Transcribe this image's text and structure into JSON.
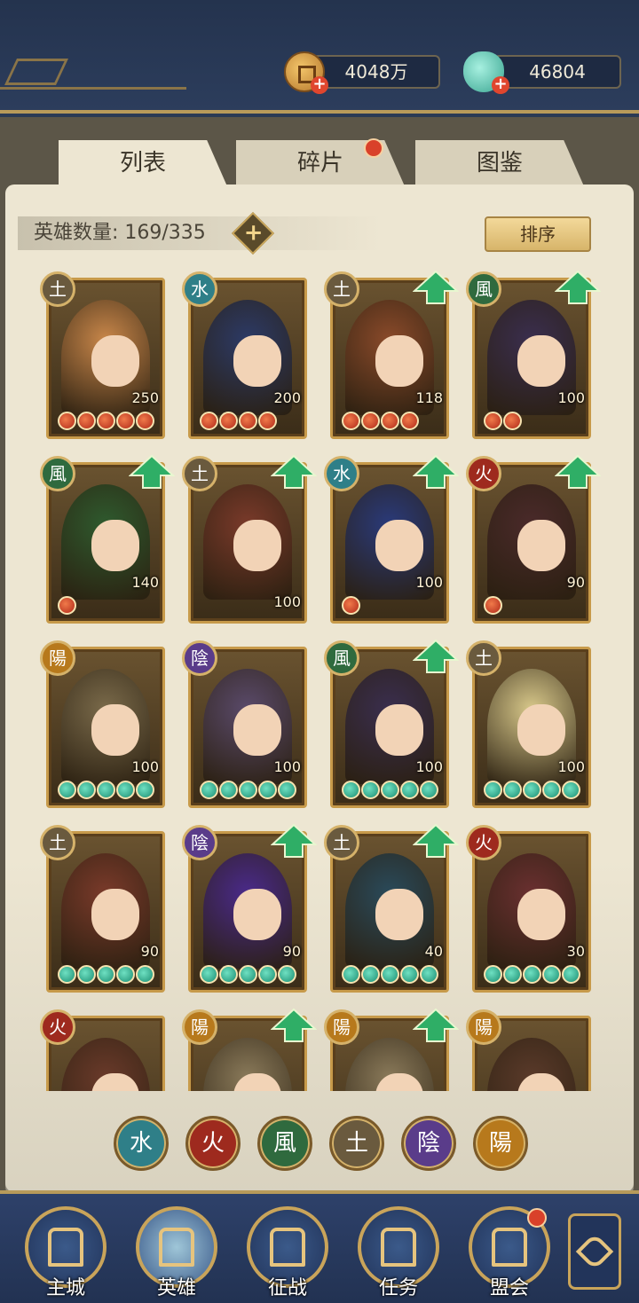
{
  "currencies": {
    "coins": "4048万",
    "jade": "46804"
  },
  "tabs": [
    {
      "label": "列表"
    },
    {
      "label": "碎片"
    },
    {
      "label": "图鉴"
    }
  ],
  "hero_count_label": "英雄数量: 169/335",
  "add_label": "+",
  "sort_label": "排序",
  "element_glyphs": {
    "water": "水",
    "fire": "火",
    "wind": "風",
    "earth": "土",
    "yin": "陰",
    "yang": "陽"
  },
  "element_colors": {
    "water": "#2f7f88",
    "fire": "#9e2a1e",
    "wind": "#2f6a3e",
    "earth": "#6a5a3e",
    "yin": "#5a3c8a",
    "yang": "#b7791c"
  },
  "heroes": [
    {
      "element": "earth",
      "level": "250",
      "stars": 5,
      "star_type": "red",
      "upgrade": false
    },
    {
      "element": "water",
      "level": "200",
      "stars": 4,
      "star_type": "red",
      "upgrade": false
    },
    {
      "element": "earth",
      "level": "118",
      "stars": 4,
      "star_type": "red",
      "upgrade": true
    },
    {
      "element": "wind",
      "level": "100",
      "stars": 2,
      "star_type": "red",
      "upgrade": true
    },
    {
      "element": "wind",
      "level": "140",
      "stars": 1,
      "star_type": "red",
      "upgrade": true
    },
    {
      "element": "earth",
      "level": "100",
      "stars": 0,
      "star_type": "red",
      "upgrade": true
    },
    {
      "element": "water",
      "level": "100",
      "stars": 1,
      "star_type": "red",
      "upgrade": true
    },
    {
      "element": "fire",
      "level": "90",
      "stars": 1,
      "star_type": "red",
      "upgrade": true
    },
    {
      "element": "yang",
      "level": "100",
      "stars": 5,
      "star_type": "jade",
      "upgrade": false
    },
    {
      "element": "yin",
      "level": "100",
      "stars": 5,
      "star_type": "jade",
      "upgrade": false
    },
    {
      "element": "wind",
      "level": "100",
      "stars": 5,
      "star_type": "jade",
      "upgrade": true
    },
    {
      "element": "earth",
      "level": "100",
      "stars": 5,
      "star_type": "jade",
      "upgrade": false
    },
    {
      "element": "earth",
      "level": "90",
      "stars": 5,
      "star_type": "jade",
      "upgrade": false
    },
    {
      "element": "yin",
      "level": "90",
      "stars": 5,
      "star_type": "jade",
      "upgrade": true
    },
    {
      "element": "earth",
      "level": "40",
      "stars": 5,
      "star_type": "jade",
      "upgrade": true
    },
    {
      "element": "fire",
      "level": "30",
      "stars": 5,
      "star_type": "jade",
      "upgrade": false
    },
    {
      "element": "fire",
      "level": "",
      "stars": 0,
      "star_type": "jade",
      "upgrade": false
    },
    {
      "element": "yang",
      "level": "",
      "stars": 0,
      "star_type": "jade",
      "upgrade": true
    },
    {
      "element": "yang",
      "level": "",
      "stars": 0,
      "star_type": "jade",
      "upgrade": true
    },
    {
      "element": "yang",
      "level": "",
      "stars": 0,
      "star_type": "jade",
      "upgrade": false
    }
  ],
  "element_filters": [
    "water",
    "fire",
    "wind",
    "earth",
    "yin",
    "yang"
  ],
  "bottom_nav": [
    {
      "label": "主城",
      "icon": "palace-icon"
    },
    {
      "label": "英雄",
      "icon": "hero-portrait-icon"
    },
    {
      "label": "征战",
      "icon": "drum-icon"
    },
    {
      "label": "任务",
      "icon": "scroll-icon"
    },
    {
      "label": "盟会",
      "icon": "pavilion-icon"
    }
  ],
  "active_nav": "英雄"
}
